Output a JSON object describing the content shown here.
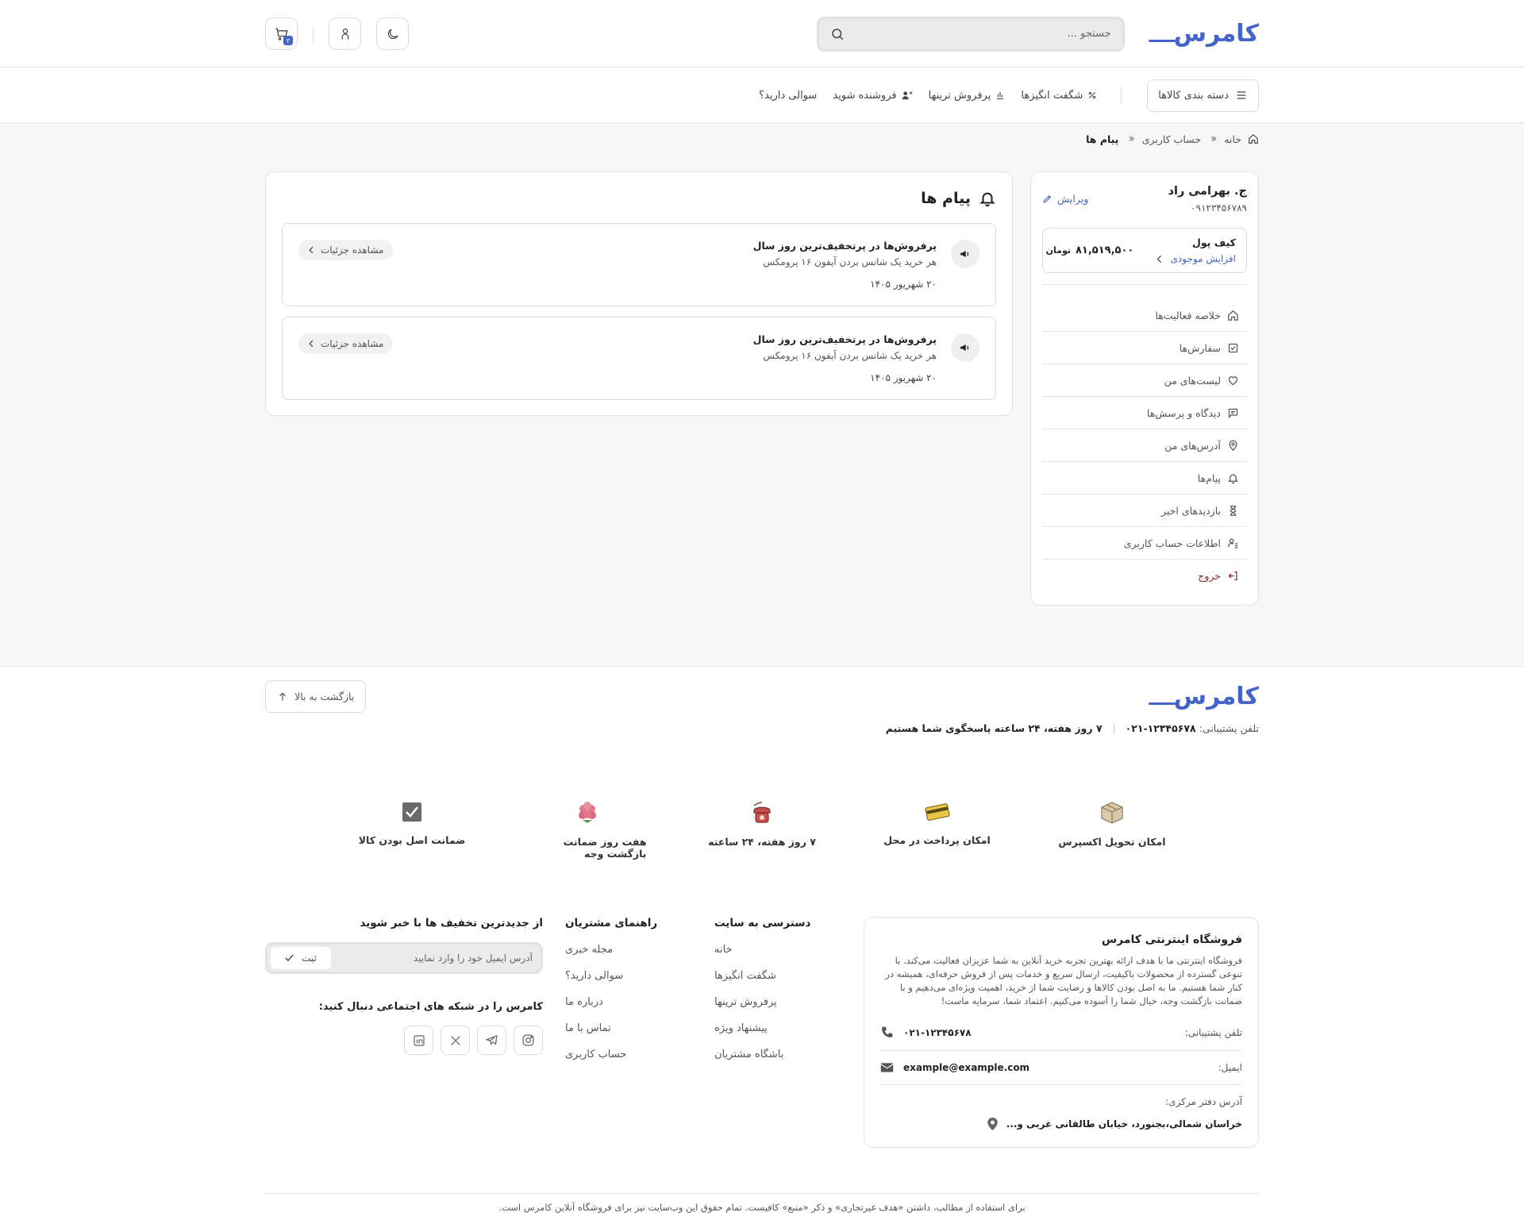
{
  "header": {
    "logo": "کامرس",
    "search_placeholder": "جستجو ...",
    "cart_count": "۳"
  },
  "nav": {
    "categories": "دسته بندی کالاها",
    "links": [
      "شگفت انگیزها",
      "پرفروش ترینها",
      "فروشنده شوید",
      "سوالی دارید؟"
    ]
  },
  "breadcrumb": [
    "خانه",
    "حساب کاربری",
    "پیام ها"
  ],
  "sidebar": {
    "name": "ج. بهرامی راد",
    "phone": "۰۹۱۲۳۴۵۶۷۸۹",
    "edit": "ویرایش",
    "wallet": {
      "title": "کیف پول",
      "increase": "افزایش موجودی",
      "amount": "۸۱,۵۱۹,۵۰۰",
      "unit": "تومان"
    },
    "menu": [
      "خلاصه فعالیت‌ها",
      "سفارش‌ها",
      "لیست‌های من",
      "دیدگاه و پرسش‌ها",
      "آدرس‌های من",
      "پیام‌ها",
      "بازدیدهای اخیر",
      "اطلاعات حساب کاربری",
      "خروج"
    ]
  },
  "messages": {
    "title": "پیام ها",
    "items": [
      {
        "title": "پرفروش‌ها در پرتخفیف‌ترین روز سال",
        "desc": "هر خرید یک شانس بردن آیفون ۱۶ پرومکس",
        "date": "۲۰ شهریور ۱۴۰۵",
        "button": "مشاهده جزئیات"
      },
      {
        "title": "پرفروش‌ها در پرتخفیف‌ترین روز سال",
        "desc": "هر خرید یک شانس بردن آیفون ۱۶ پرومکس",
        "date": "۲۰ شهریور ۱۴۰۵",
        "button": "مشاهده جزئیات"
      }
    ]
  },
  "footer": {
    "logo": "کامرس",
    "back_to_top": "بازگشت به بالا",
    "support_label": "تلفن پشتیبانی:",
    "support_phone": "۰۲۱-۱۲۳۴۵۶۷۸",
    "support_hours": "۷ روز هفته، ۲۴ ساعته پاسخگوی شما هستیم",
    "features": [
      "امکان تحویل اکسپرس",
      "امکان پرداخت در محل",
      "۷ روز هفته، ۲۴ ساعته",
      "هفت روز ضمانت بازگشت وجه",
      "ضمانت اصل بودن کالا"
    ],
    "about": {
      "title": "فروشگاه اینترنتی کامرس",
      "text": "فروشگاه اینترنتی ما با هدف ارائه بهترین تجربه خرید آنلاین به شما عزیزان فعالیت می‌کند. با تنوعی گسترده از محصولات باکیفیت، ارسال سریع و خدمات پس از فروش حرفه‌ای، همیشه در کنار شما هستیم. ما به اصل بودن کالاها و رضایت شما از خرید، اهمیت ویژه‌ای می‌دهیم و با ضمانت بازگشت وجه، خیال شما را آسوده می‌کنیم. اعتماد شما، سرمایه ماست!",
      "phone_label": "تلفن پشتیبانی:",
      "phone": "۰۲۱-۱۲۳۴۵۶۷۸",
      "email_label": "ایمیل:",
      "email": "example@example.com",
      "address_label": "آدرس دفتر مرکزی:",
      "address": "خراسان شمالی،بجنورد، خیابان طالقانی غربی و..."
    },
    "col1": {
      "title": "دسترسی به سایت",
      "links": [
        "خانه",
        "شگفت انگیزها",
        "پرفروش ترینها",
        "پیشنهاد ویژه",
        "باشگاه مشتریان"
      ]
    },
    "col2": {
      "title": "راهنمای مشتریان",
      "links": [
        "مجله خبری",
        "سوالی دارید؟",
        "درباره ما",
        "تماس با ما",
        "حساب کاربری"
      ]
    },
    "newsletter": {
      "title": "از جدیدترین تخفیف ها با خبر شوید",
      "placeholder": "آدرس ایمیل خود را وارد نمایید",
      "button": "ثبت",
      "social_title": "کامرس را در شبکه های اجتماعی دنبال کنید:"
    },
    "copyright": "برای استفاده از مطالب، داشتن «هدف غیرتجاری» و ذکر «منبع» کافیست. تمام حقوق این وب‌سایت نیز برای فروشگاه آنلاین کامرس است."
  }
}
